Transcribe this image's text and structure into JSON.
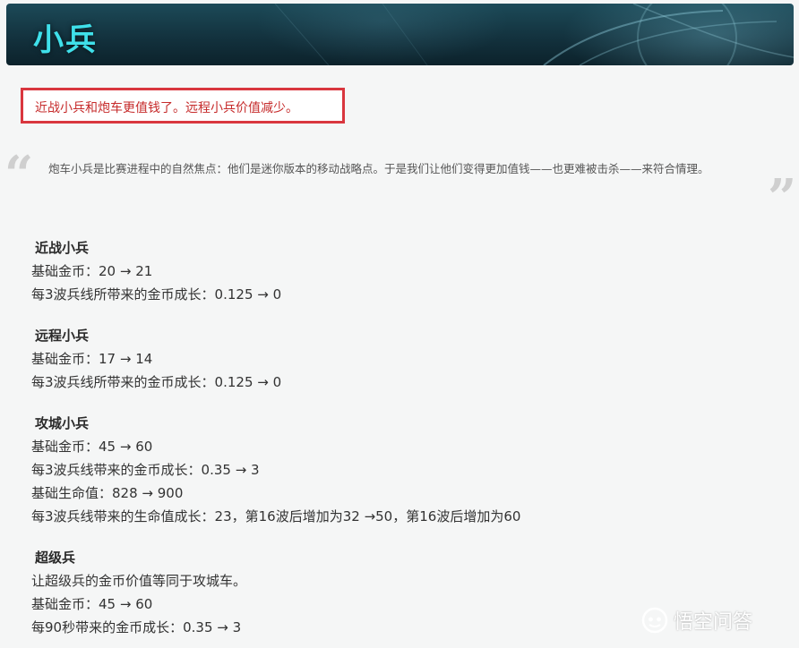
{
  "banner": {
    "title": "小兵"
  },
  "note": {
    "text": "近战小兵和炮车更值钱了。远程小兵价值减少。"
  },
  "quote": {
    "open_mark": "“",
    "close_mark": "”",
    "text": "炮车小兵是比赛进程中的自然焦点：他们是迷你版本的移动战略点。于是我们让他们变得更加值钱——也更难被击杀——来符合情理。"
  },
  "sections": {
    "melee": {
      "title": "近战小兵",
      "base_gold": "基础金币：20 → 21",
      "gold_growth": "每3波兵线所带来的金币成长：0.125 → 0"
    },
    "ranged": {
      "title": "远程小兵",
      "base_gold": "基础金币：17 → 14",
      "gold_growth": "每3波兵线所带来的金币成长：0.125 → 0"
    },
    "siege": {
      "title": "攻城小兵",
      "base_gold": "基础金币：45 → 60",
      "gold_growth": "每3波兵线带来的金币成长：0.35 → 3",
      "base_health": "基础生命值：828 → 900",
      "health_growth": "每3波兵线带来的生命值成长：23，第16波后增加为32 →50，第16波后增加为60"
    },
    "super": {
      "title": "超级兵",
      "desc": "让超级兵的金币价值等同于攻城车。",
      "base_gold": "基础金币：45 → 60",
      "gold_growth": "每90秒带来的金币成长：0.35 → 3"
    }
  },
  "watermark": {
    "text": "悟空问答"
  }
}
